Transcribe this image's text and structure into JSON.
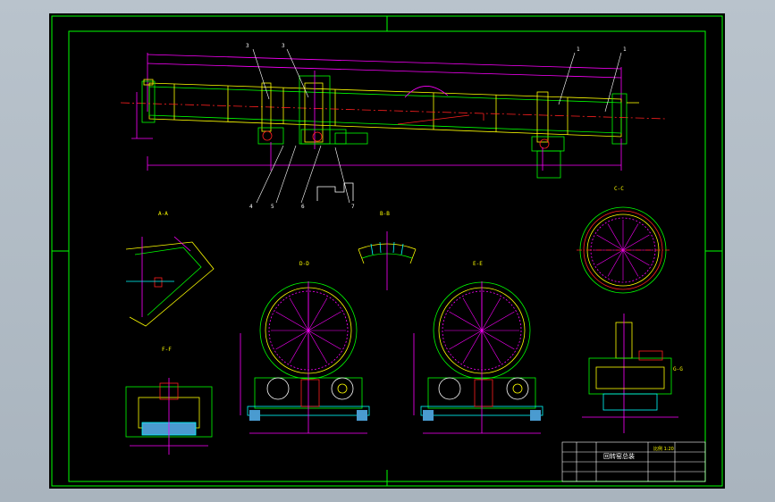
{
  "drawing": {
    "title_block": {
      "drawing_name": "回转窑总装",
      "scale_label": "比例 1:20"
    },
    "view_labels": [
      "A-A",
      "B-B",
      "C-C",
      "D-D",
      "E-E",
      "F-F",
      "G-G",
      "H-H"
    ],
    "part_numbers": [
      "1",
      "2",
      "3",
      "4",
      "5",
      "6",
      "7"
    ],
    "colors": {
      "frame": "#00ff00",
      "outline": "#ffff00",
      "center": "#ff00ff",
      "dim": "#00ffff",
      "red": "#ff2020",
      "white": "#ffffff",
      "background": "#000000"
    }
  }
}
